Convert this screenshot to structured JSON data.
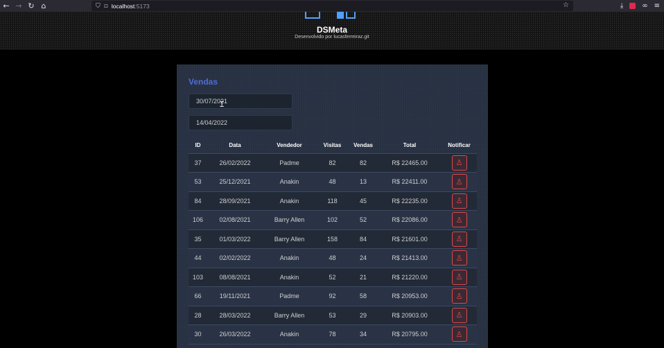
{
  "browser": {
    "url_host": "localhost",
    "url_port": ":5173"
  },
  "header": {
    "title": "DSMeta",
    "subtitle": "Desenvolvido por lucasferreiraz.git"
  },
  "card": {
    "title": "Vendas",
    "date_min": "30/07/2021",
    "date_max": "14/04/2022"
  },
  "table": {
    "columns": [
      "ID",
      "Data",
      "Vendedor",
      "Visitas",
      "Vendas",
      "Total",
      "Notificar"
    ],
    "rows": [
      {
        "id": "37",
        "date": "26/02/2022",
        "seller": "Padme",
        "visits": "82",
        "sales": "82",
        "total": "R$ 22465.00"
      },
      {
        "id": "53",
        "date": "25/12/2021",
        "seller": "Anakin",
        "visits": "48",
        "sales": "13",
        "total": "R$ 22411.00"
      },
      {
        "id": "84",
        "date": "28/09/2021",
        "seller": "Anakin",
        "visits": "118",
        "sales": "45",
        "total": "R$ 22235.00"
      },
      {
        "id": "106",
        "date": "02/08/2021",
        "seller": "Barry Allen",
        "visits": "102",
        "sales": "52",
        "total": "R$ 22086.00"
      },
      {
        "id": "35",
        "date": "01/03/2022",
        "seller": "Barry Allen",
        "visits": "158",
        "sales": "84",
        "total": "R$ 21601.00"
      },
      {
        "id": "44",
        "date": "02/02/2022",
        "seller": "Anakin",
        "visits": "48",
        "sales": "24",
        "total": "R$ 21413.00"
      },
      {
        "id": "103",
        "date": "08/08/2021",
        "seller": "Anakin",
        "visits": "52",
        "sales": "21",
        "total": "R$ 21220.00"
      },
      {
        "id": "66",
        "date": "19/11/2021",
        "seller": "Padme",
        "visits": "92",
        "sales": "58",
        "total": "R$ 20953.00"
      },
      {
        "id": "28",
        "date": "28/03/2022",
        "seller": "Barry Allen",
        "visits": "53",
        "sales": "29",
        "total": "R$ 20903.00"
      },
      {
        "id": "30",
        "date": "26/03/2022",
        "seller": "Anakin",
        "visits": "78",
        "sales": "34",
        "total": "R$ 20795.00"
      }
    ]
  },
  "icons": {
    "notify": "user-bell-icon"
  },
  "colors": {
    "accent": "#4d6dd8",
    "notify": "#e04848"
  }
}
